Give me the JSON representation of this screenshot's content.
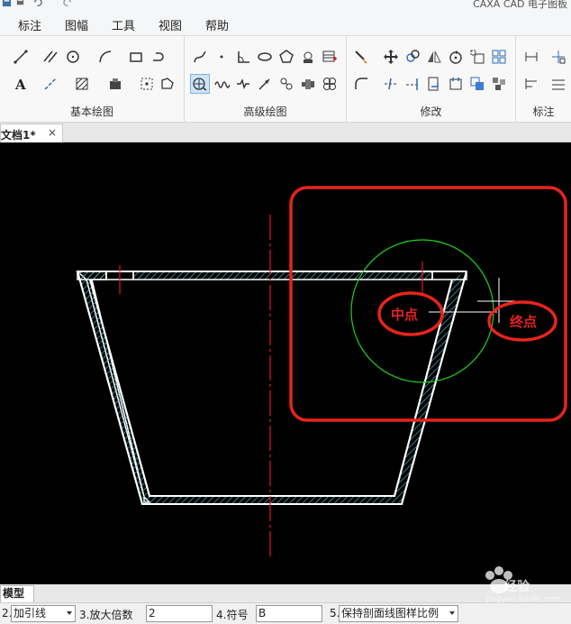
{
  "app": {
    "title": "CAXA CAD 电子图板"
  },
  "menu": {
    "tabs": [
      {
        "label": "标注"
      },
      {
        "label": "图幅"
      },
      {
        "label": "工具"
      },
      {
        "label": "视图"
      },
      {
        "label": "帮助"
      }
    ]
  },
  "ribbon": {
    "groups": [
      {
        "label": "基本绘图"
      },
      {
        "label": "高级绘图"
      },
      {
        "label": "修改"
      },
      {
        "label": "标注"
      }
    ]
  },
  "document": {
    "tab_label": "文档1*",
    "close_glyph": "×"
  },
  "canvas": {
    "midpoint_label": "中点",
    "endpoint_label": "终点",
    "colors": {
      "background": "#000000",
      "outline": "#ffffff",
      "hatch": "#4fb0b8",
      "centerline": "#e0182c",
      "circle": "#1fd21f",
      "annotation": "#e8241c"
    }
  },
  "model_tab": {
    "label": "模型"
  },
  "command_bar": {
    "item1_value": "加引线",
    "item1_prefix": "2.",
    "item2_label": "3.放大倍数",
    "item2_value": "2",
    "item3_label": "4.符号",
    "item3_value": "B",
    "item4_prefix": "5.",
    "item4_value": "保持剖面线图样比例"
  },
  "watermark": {
    "text": "经验",
    "sub": "jingyan.baidu.com"
  }
}
